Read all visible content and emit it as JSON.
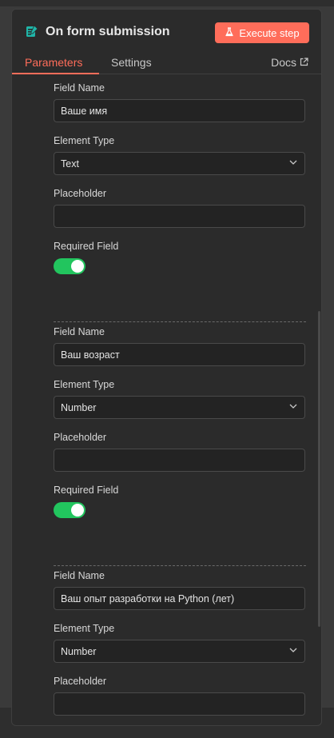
{
  "header": {
    "title": "On form submission",
    "execute_label": "Execute step"
  },
  "tabs": [
    {
      "label": "Parameters",
      "active": true
    },
    {
      "label": "Settings",
      "active": false
    }
  ],
  "docs_label": "Docs",
  "fields": [
    {
      "field_name_label": "Field Name",
      "field_name_value": "Ваше имя",
      "element_type_label": "Element Type",
      "element_type_value": "Text",
      "placeholder_label": "Placeholder",
      "placeholder_value": "",
      "required_label": "Required Field",
      "required": true
    },
    {
      "field_name_label": "Field Name",
      "field_name_value": "Ваш возраст",
      "element_type_label": "Element Type",
      "element_type_value": "Number",
      "placeholder_label": "Placeholder",
      "placeholder_value": "",
      "required_label": "Required Field",
      "required": true
    },
    {
      "field_name_label": "Field Name",
      "field_name_value": "Ваш опыт разработки на Python (лет)",
      "element_type_label": "Element Type",
      "element_type_value": "Number",
      "placeholder_label": "Placeholder",
      "placeholder_value": ""
    }
  ],
  "colors": {
    "accent": "#ff6d5a",
    "toggle_on": "#22c55e",
    "icon_teal": "#1fb5a8"
  },
  "icons": {
    "node": "form-icon",
    "execute": "flask-icon",
    "docs": "external-link-icon",
    "select": "chevron-down-icon"
  }
}
